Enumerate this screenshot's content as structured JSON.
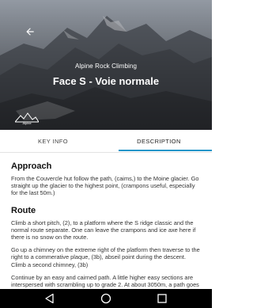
{
  "header": {
    "subtitle": "Alpine Rock Climbing",
    "title": "Face S - Voie normale",
    "logo_text": "Alpine"
  },
  "tabs": [
    {
      "label": "KEY INFO",
      "selected": false
    },
    {
      "label": "DESCRIPTION",
      "selected": true
    }
  ],
  "accent_color": "#2196c9",
  "sections": [
    {
      "heading": "Approach",
      "paragraphs": [
        "From the Couvercle hut follow the path, (caims,) to the Moine glacier. Go straight up the glacier to the highest point, (crampons useful, especially for the last 50m.)"
      ]
    },
    {
      "heading": "Route",
      "paragraphs": [
        "Climb a short pitch, (2), to a platform where the S ridge classic and the normal route separate. One can leave the crampons and ice axe here if there is no snow on the route.",
        "Go up a chimney on the extreme right of the platform then traverse to the right to a commerative plaque, (3b), abseil point during the descent. Climb a second chimney, (3b)",
        "Continue by an easy and cairned path. A little higher easy sections are interspersed with scrambling up to grade 2. At about 3050m, a path goes to the left and passes through a"
      ]
    }
  ],
  "icons": {
    "back": "arrow-back-icon",
    "nav_back": "nav-back-icon",
    "nav_home": "nav-home-icon",
    "nav_recents": "nav-recents-icon"
  }
}
